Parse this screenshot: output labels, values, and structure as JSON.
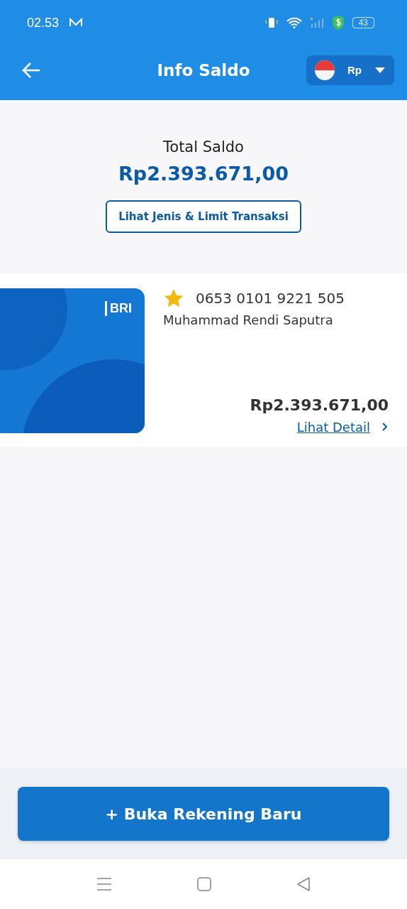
{
  "status_bar": {
    "time": "02.53",
    "battery": "43"
  },
  "header": {
    "title": "Info Saldo",
    "currency": "Rp"
  },
  "total": {
    "label": "Total Saldo",
    "amount": "Rp2.393.671,00",
    "limit_button": "Lihat Jenis & Limit Transaksi"
  },
  "accounts": [
    {
      "card_brand": "BRI",
      "favorite": true,
      "number": "0653 0101 9221 505",
      "name": "Muhammad Rendi Saputra",
      "balance": "Rp2.393.671,00",
      "detail_link": "Lihat Detail"
    }
  ],
  "footer_button": "+ Buka Rekening Baru"
}
